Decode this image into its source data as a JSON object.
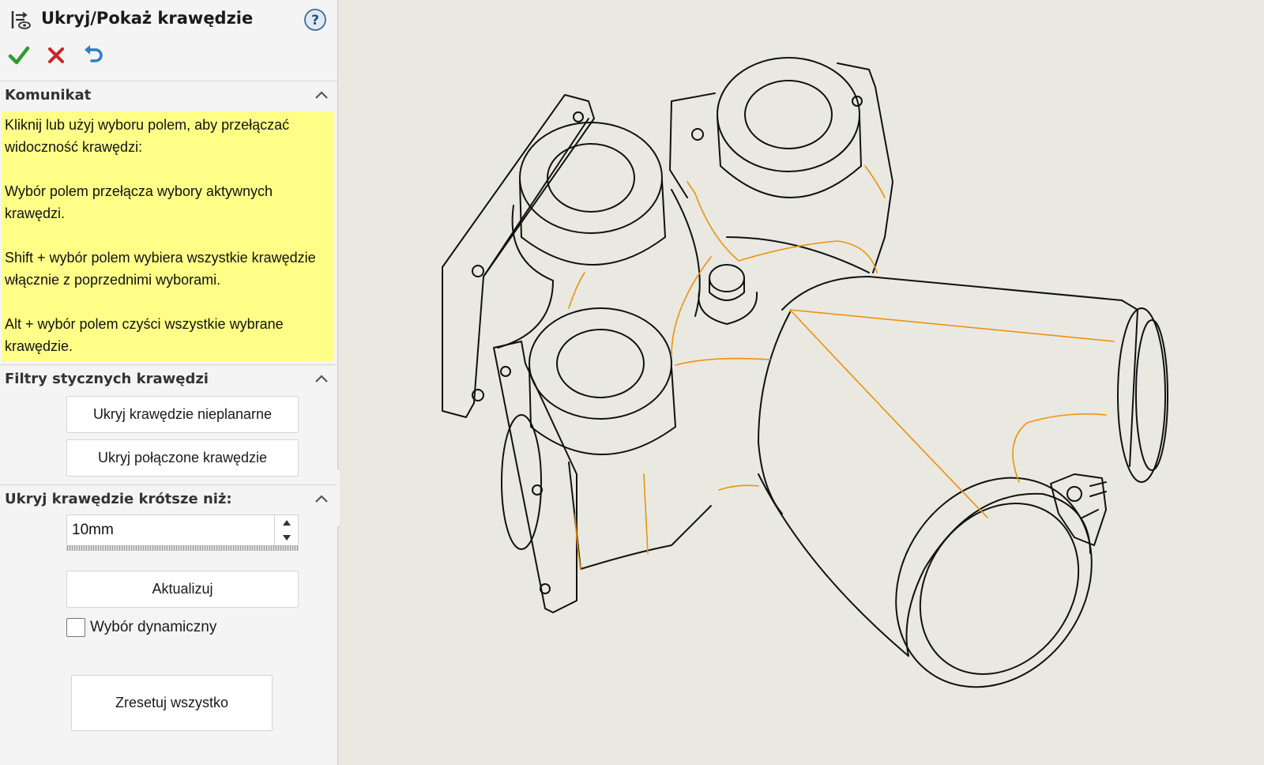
{
  "panel": {
    "title": "Ukryj/Pokaż krawędzie",
    "title_icon": "edge-visibility-icon",
    "help_icon": "help-icon",
    "actions": {
      "ok": "check-icon",
      "cancel": "close-icon",
      "undo": "undo-icon"
    },
    "sections": {
      "message": {
        "label": "Komunikat",
        "paragraphs": [
          "Kliknij lub użyj wyboru polem, aby przełączać widoczność krawędzi:",
          "Wybór polem przełącza wybory aktywnych krawędzi.",
          "Shift + wybór polem wybiera wszystkie krawędzie włącznie z poprzednimi wyborami.",
          "Alt + wybór polem czyści wszystkie wybrane krawędzie."
        ]
      },
      "tangent_filters": {
        "label": "Filtry stycznych krawędzi",
        "hide_nonplanar_button": "Ukryj krawędzie nieplanarne",
        "hide_connected_button": "Ukryj połączone krawędzie"
      },
      "short_edges": {
        "label": "Ukryj krawędzie krótsze niż:",
        "length_value": "10mm",
        "update_button": "Aktualizuj",
        "dynamic_selection_label": "Wybór dynamiczny",
        "dynamic_selection_checked": false
      }
    },
    "reset_button": "Zresetuj wszystko"
  },
  "colors": {
    "message_background": "#ffff88",
    "ok_green": "#2e9a2e",
    "cancel_red": "#d22020",
    "undo_blue": "#2c7fc0",
    "viewport_background": "#e9e9e1",
    "tangent_edge_orange": "#f0900f",
    "model_edge_black": "#111111"
  }
}
